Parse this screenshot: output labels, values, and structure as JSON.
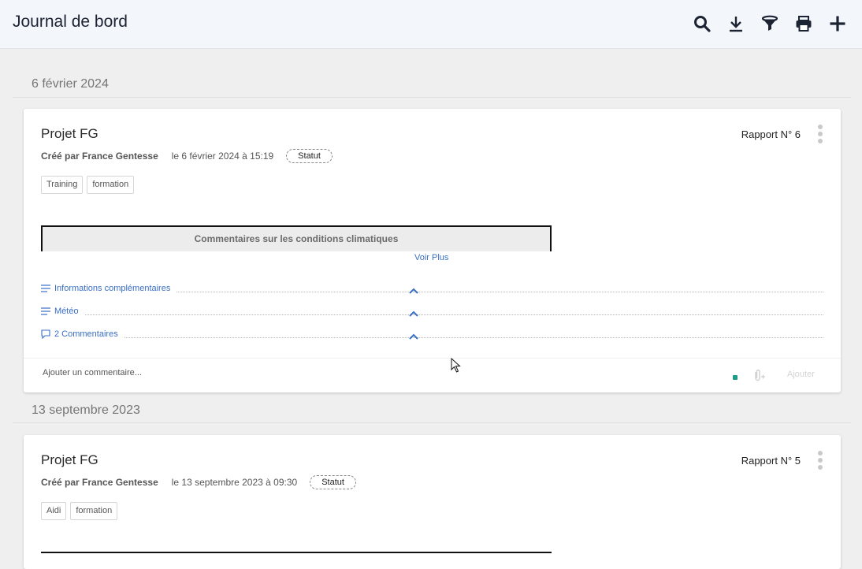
{
  "header": {
    "title": "Journal de bord",
    "icons": [
      "search-icon",
      "download-icon",
      "filter-icon",
      "print-icon",
      "plus-icon"
    ]
  },
  "colors": {
    "link": "#3a6fc4",
    "accent_green": "#1e9c88",
    "topbar_bg": "#f3f6fb",
    "page_bg": "#efefef"
  },
  "groups": [
    {
      "date": "6 février 2024",
      "report": {
        "title": "Projet FG",
        "report_number": "Rapport N° 6",
        "author": "Créé par France Gentesse",
        "created": "le 6 février 2024 à 15:19",
        "status": "Statut",
        "tags": [
          "Training",
          "formation"
        ],
        "document_title": "Commentaires sur les conditions climatiques",
        "see_more": "Voir Plus",
        "sections": [
          {
            "label": "Informations complémentaires",
            "icon": "list-icon"
          },
          {
            "label": "Météo",
            "icon": "list-icon"
          },
          {
            "label": "2 Commentaires",
            "icon": "comment-icon"
          }
        ],
        "comment_placeholder": "Ajouter un commentaire...",
        "add_label": "Ajouter"
      }
    },
    {
      "date": "13 septembre 2023",
      "report": {
        "title": "Projet FG",
        "report_number": "Rapport N° 5",
        "author": "Créé par France Gentesse",
        "created": "le 13 septembre 2023 à 09:30",
        "status": "Statut",
        "tags": [
          "Aidi",
          "formation"
        ]
      }
    }
  ]
}
